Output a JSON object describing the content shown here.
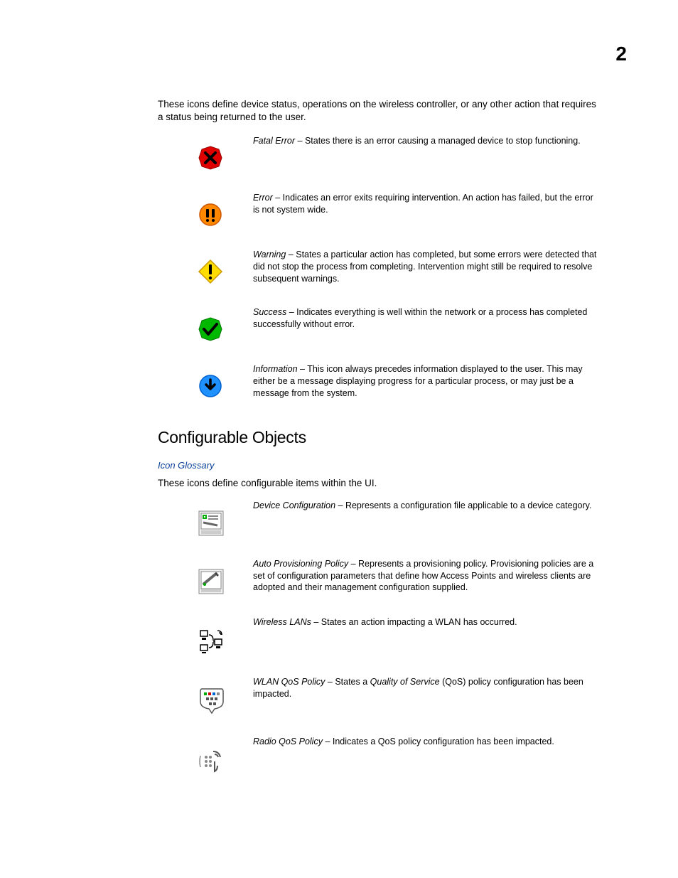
{
  "page_number": "2",
  "intro": "These icons define device status, operations on the wireless controller, or any other action that requires a status being returned to the user.",
  "status_icons": [
    {
      "term": "Fatal Error",
      "desc": " – States there is an error causing a managed device to stop functioning."
    },
    {
      "term": "Error",
      "desc": " – Indicates an error exits requiring intervention. An action has failed, but the error is not system wide."
    },
    {
      "term": "Warning",
      "desc": " – States a particular action has completed, but some errors were detected that did not stop the process from completing. Intervention might still be required to resolve subsequent warnings."
    },
    {
      "term": "Success",
      "desc": " – Indicates everything is well within the network or a process has completed successfully without error."
    },
    {
      "term": "Information",
      "desc": " – This icon always precedes information displayed to the user. This may either be a message displaying progress for a particular process, or may just be a message from the system."
    }
  ],
  "section_title": "Configurable Objects",
  "glossary_link": "Icon Glossary",
  "sub_intro": "These icons define configurable items within the UI.",
  "config_icons": [
    {
      "term": "Device Configuration",
      "desc": " – Represents a configuration file applicable to a device category."
    },
    {
      "term": "Auto Provisioning Policy",
      "desc": " – Represents a provisioning policy. Provisioning policies are a set of configuration parameters that define how Access Points and wireless clients are adopted and their management configuration supplied."
    },
    {
      "term": "Wireless LANs",
      "desc": " – States an action impacting a WLAN has occurred."
    },
    {
      "term": "WLAN QoS Policy",
      "pre": " – States a ",
      "ital": "Quality of Service",
      "post": " (QoS) policy configuration has been impacted."
    },
    {
      "term": "Radio QoS Policy",
      "desc": " – Indicates a QoS policy configuration has been impacted."
    }
  ]
}
